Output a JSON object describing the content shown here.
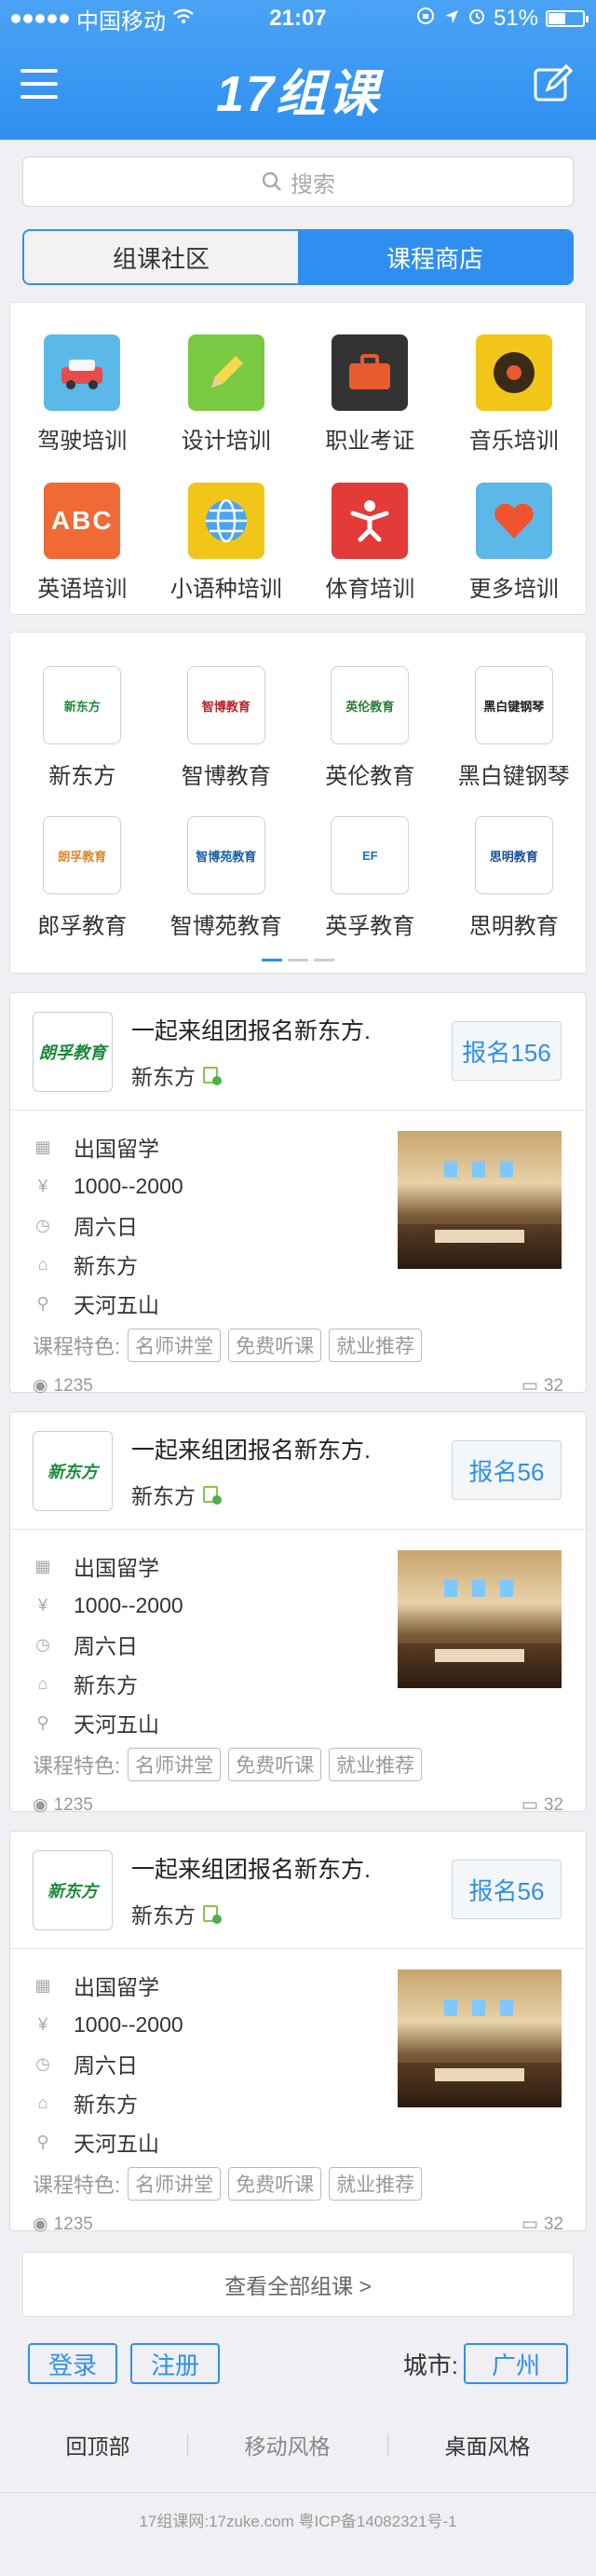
{
  "status_bar": {
    "carrier": "中国移动",
    "time": "21:07",
    "battery": "51%",
    "battery_level": 0.51
  },
  "header": {
    "logo": "17组课"
  },
  "search": {
    "placeholder": "搜索"
  },
  "tabs": [
    {
      "label": "组课社区",
      "active": false
    },
    {
      "label": "课程商店",
      "active": true
    }
  ],
  "categories": [
    {
      "label": "驾驶培训",
      "icon": "car-icon",
      "color": "#5bb8e8"
    },
    {
      "label": "设计培训",
      "icon": "pencil-icon",
      "color": "#7ac943"
    },
    {
      "label": "职业考证",
      "icon": "briefcase-icon",
      "color": "#333333"
    },
    {
      "label": "音乐培训",
      "icon": "record-icon",
      "color": "#f2c618"
    },
    {
      "label": "英语培训",
      "icon": "abc-icon",
      "color": "#f06a35"
    },
    {
      "label": "小语种培训",
      "icon": "globe-icon",
      "color": "#f2c618"
    },
    {
      "label": "体育培训",
      "icon": "athlete-icon",
      "color": "#e33a3a"
    },
    {
      "label": "更多培训",
      "icon": "heart-icon",
      "color": "#5bb8e8"
    }
  ],
  "organizations": [
    {
      "label": "新东方",
      "logo_text": "新东方"
    },
    {
      "label": "智博教育",
      "logo_text": "智博教育"
    },
    {
      "label": "英伦教育",
      "logo_text": "英伦教育"
    },
    {
      "label": "黑白键钢琴",
      "logo_text": "黑白键钢琴"
    },
    {
      "label": "郎孚教育",
      "logo_text": "朗孚教育"
    },
    {
      "label": "智博苑教育",
      "logo_text": "智博苑教育"
    },
    {
      "label": "英孚教育",
      "logo_text": "EF"
    },
    {
      "label": "思明教育",
      "logo_text": "思明教育"
    }
  ],
  "courses": [
    {
      "title": "一起来组团报名新东方.",
      "org": "新东方",
      "logo_text": "朗孚教育",
      "signup": "报名156",
      "category": "出国留学",
      "price": "1000--2000",
      "day": "周六日",
      "school": "新东方",
      "location": "天河五山",
      "features_label": "课程特色:",
      "tags": [
        "名师讲堂",
        "免费听课",
        "就业推荐"
      ],
      "views": "1235",
      "comments": "32"
    },
    {
      "title": "一起来组团报名新东方.",
      "org": "新东方",
      "logo_text": "新东方",
      "signup": "报名56",
      "category": "出国留学",
      "price": "1000--2000",
      "day": "周六日",
      "school": "新东方",
      "location": "天河五山",
      "features_label": "课程特色:",
      "tags": [
        "名师讲堂",
        "免费听课",
        "就业推荐"
      ],
      "views": "1235",
      "comments": "32"
    },
    {
      "title": "一起来组团报名新东方.",
      "org": "新东方",
      "logo_text": "新东方",
      "signup": "报名56",
      "category": "出国留学",
      "price": "1000--2000",
      "day": "周六日",
      "school": "新东方",
      "location": "天河五山",
      "features_label": "课程特色:",
      "tags": [
        "名师讲堂",
        "免费听课",
        "就业推荐"
      ],
      "views": "1235",
      "comments": "32"
    }
  ],
  "more_link": "查看全部组课 >",
  "account": {
    "login": "登录",
    "register": "注册",
    "city_label": "城市:",
    "city": "广州"
  },
  "footer": {
    "links": [
      "回顶部",
      "移动风格",
      "桌面风格"
    ],
    "copyright": "17组课网:17zuke.com 粤ICP备14082321号-1"
  }
}
